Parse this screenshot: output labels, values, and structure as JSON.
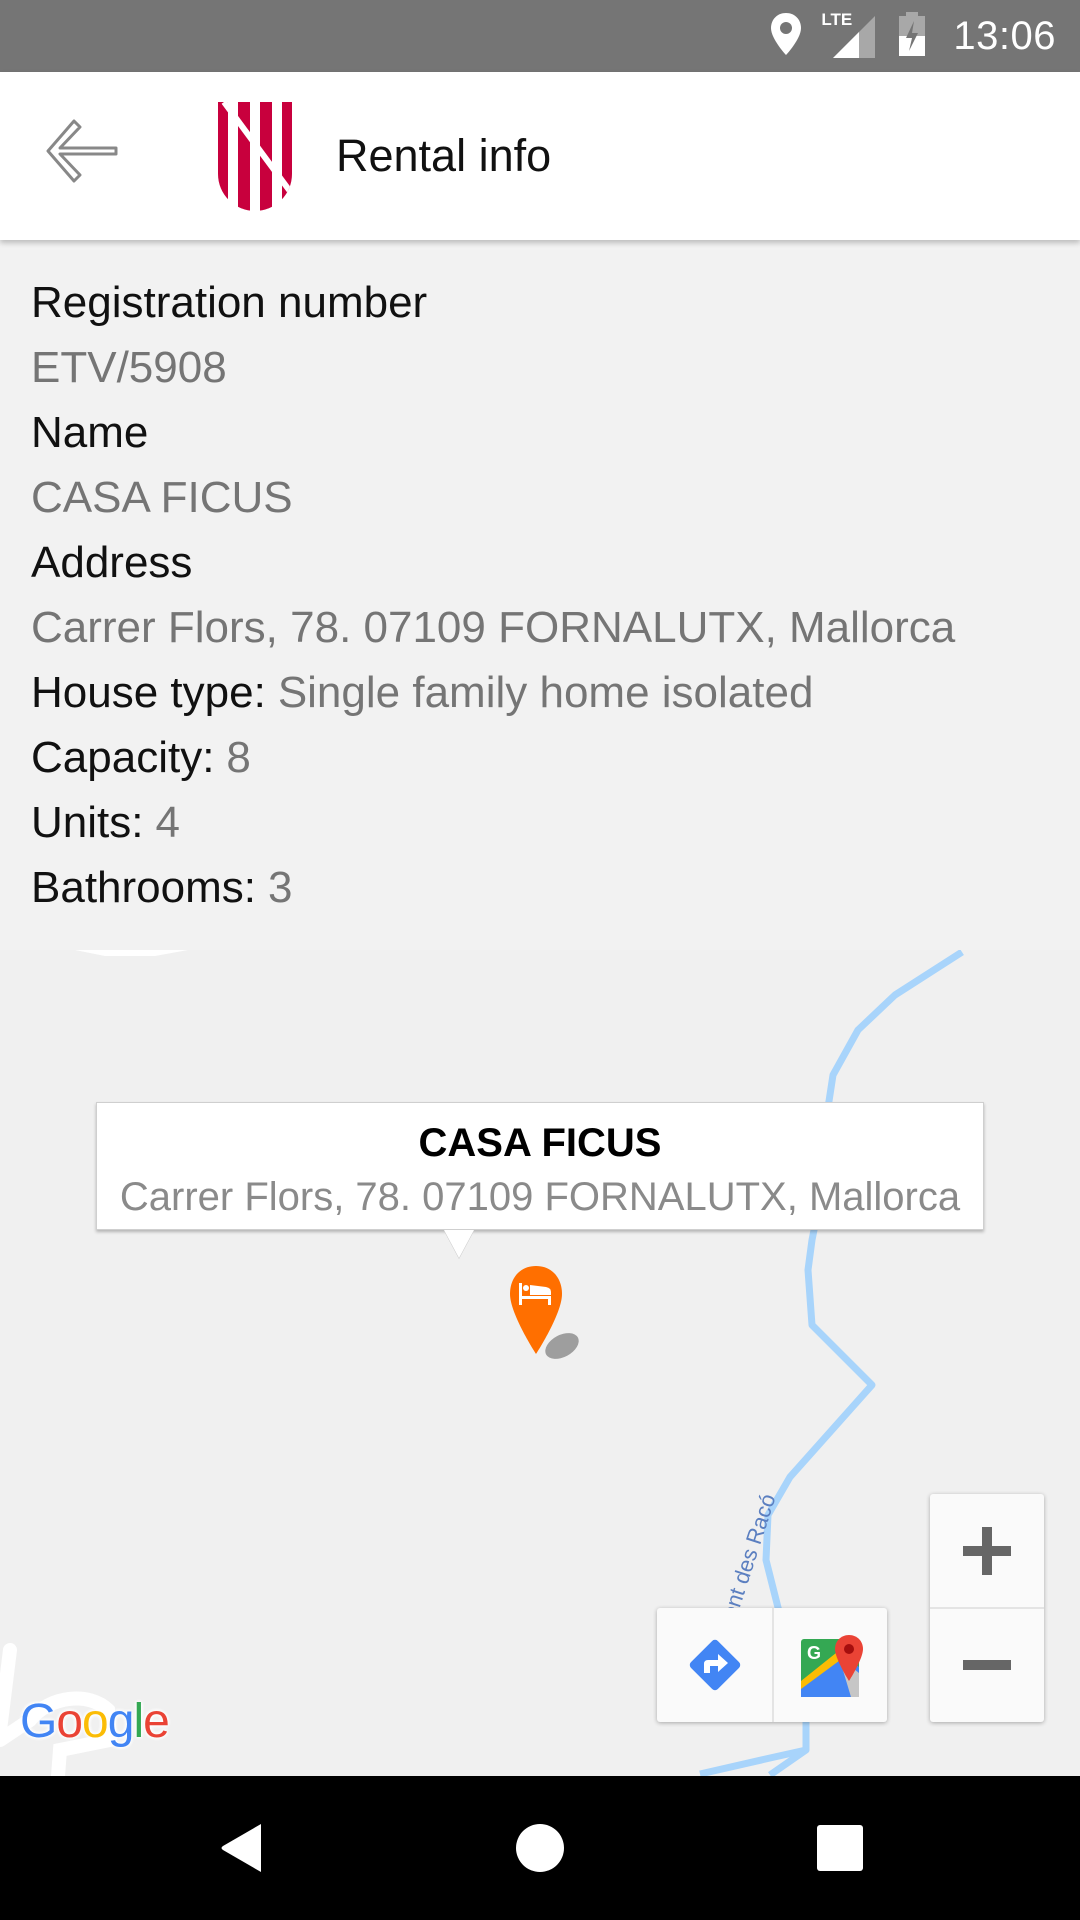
{
  "status_bar": {
    "time": "13:06",
    "icons": [
      "location-icon",
      "lte-signal-icon",
      "battery-charging-icon"
    ],
    "network_label": "LTE"
  },
  "app_bar": {
    "back_icon": "arrow-left-icon",
    "logo": "govern-illes-balears-logo",
    "title": "Rental info"
  },
  "details": {
    "registration_number": {
      "label": "Registration number",
      "value": "ETV/5908"
    },
    "name": {
      "label": "Name",
      "value": "CASA FICUS"
    },
    "address": {
      "label": "Address",
      "value": "Carrer Flors, 78. 07109 FORNALUTX, Mallorca"
    },
    "house_type": {
      "label": "House type:",
      "value": "Single family home isolated"
    },
    "capacity": {
      "label": "Capacity:",
      "value": "8"
    },
    "units": {
      "label": "Units:",
      "value": "4"
    },
    "bathrooms": {
      "label": "Bathrooms:",
      "value": "3"
    }
  },
  "map": {
    "info_window": {
      "title": "CASA FICUS",
      "address": "Carrer Flors, 78. 07109 FORNALUTX, Mallorca"
    },
    "marker_icon": "bed-icon",
    "street_label": "Torrent des Racó",
    "attribution": "Google",
    "controls": {
      "directions_icon": "directions-icon",
      "open_in_maps_icon": "google-maps-icon",
      "zoom_in": "+",
      "zoom_out": "−"
    },
    "colors": {
      "marker": "#ff6f00",
      "water": "#a8d4fb",
      "background": "#f0f0f0"
    }
  },
  "nav_bar": {
    "icons": [
      "back-triangle-icon",
      "home-circle-icon",
      "recents-square-icon"
    ]
  },
  "theme": {
    "brand_red": "#c8003d",
    "status_bar_bg": "#757575"
  }
}
